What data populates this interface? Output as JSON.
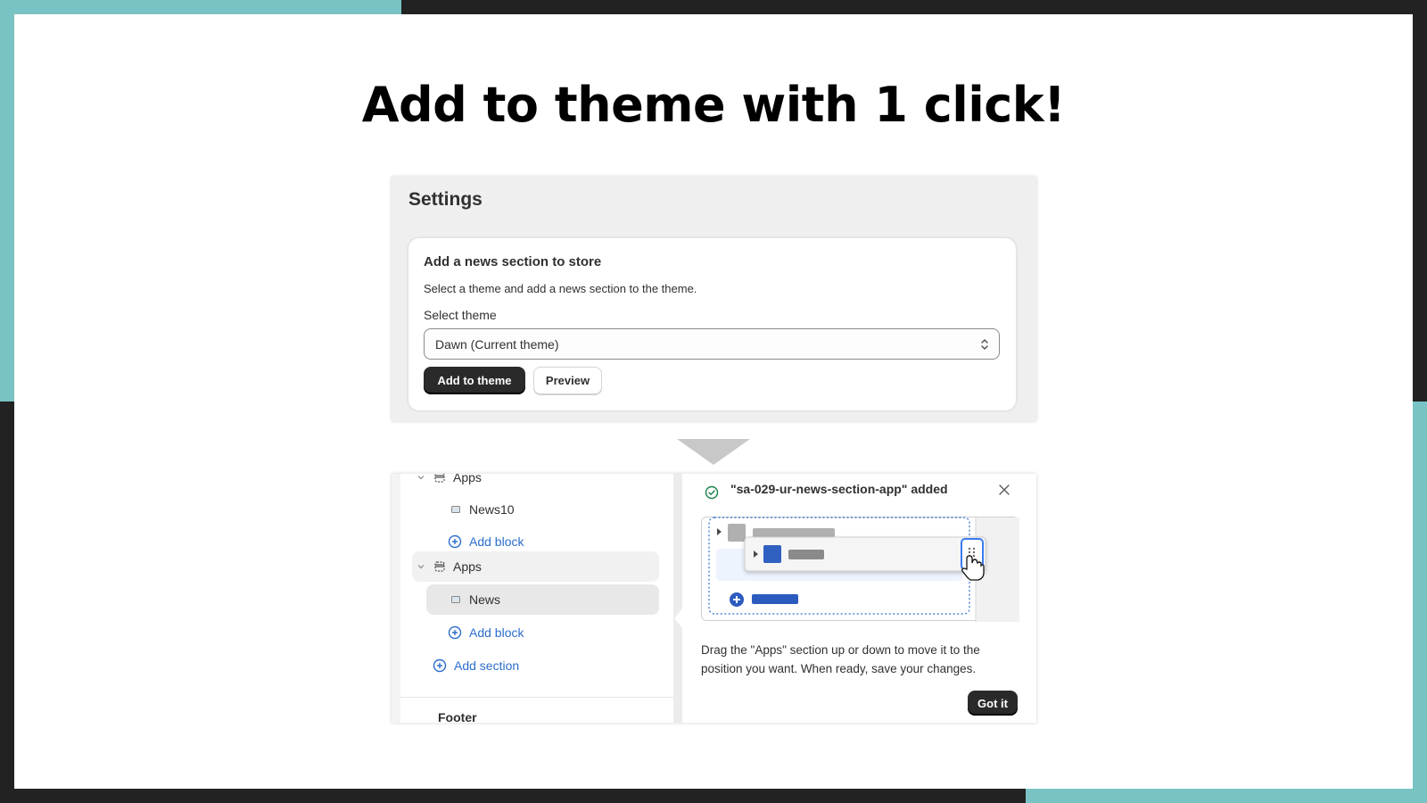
{
  "slide": {
    "title": "Add to theme with 1 click!",
    "colors": {
      "teal": "#79c3c4",
      "dark": "#222222",
      "accent_blue": "#2c6ecb",
      "success_green": "#1a7f4b"
    }
  },
  "settings": {
    "title": "Settings",
    "card": {
      "title": "Add a news section to store",
      "description": "Select a theme and add a news section to the theme.",
      "select_label": "Select theme",
      "select_value": "Dawn (Current theme)",
      "primary_button": "Add to theme",
      "secondary_button": "Preview"
    }
  },
  "editor": {
    "tree": [
      {
        "type": "section",
        "label": "Apps",
        "icon": "section-icon",
        "expanded": true
      },
      {
        "type": "block",
        "label": "News10",
        "icon": "block-icon"
      },
      {
        "type": "add",
        "label": "Add block",
        "icon": "plus-circle-icon"
      },
      {
        "type": "section",
        "label": "Apps",
        "icon": "section-icon",
        "expanded": true,
        "highlighted": true
      },
      {
        "type": "block",
        "label": "News",
        "icon": "block-icon",
        "selected": true
      },
      {
        "type": "add",
        "label": "Add block",
        "icon": "plus-circle-icon"
      },
      {
        "type": "add-section",
        "label": "Add section",
        "icon": "plus-circle-icon"
      }
    ],
    "footer_label": "Footer",
    "popover": {
      "status_icon": "check-circle-icon",
      "title": "\"sa-029-ur-news-section-app\" added",
      "close_icon": "close-icon",
      "message": "Drag the \"Apps\" section up or down to move it to the position you want. When ready, save your changes.",
      "button": "Got it"
    }
  }
}
